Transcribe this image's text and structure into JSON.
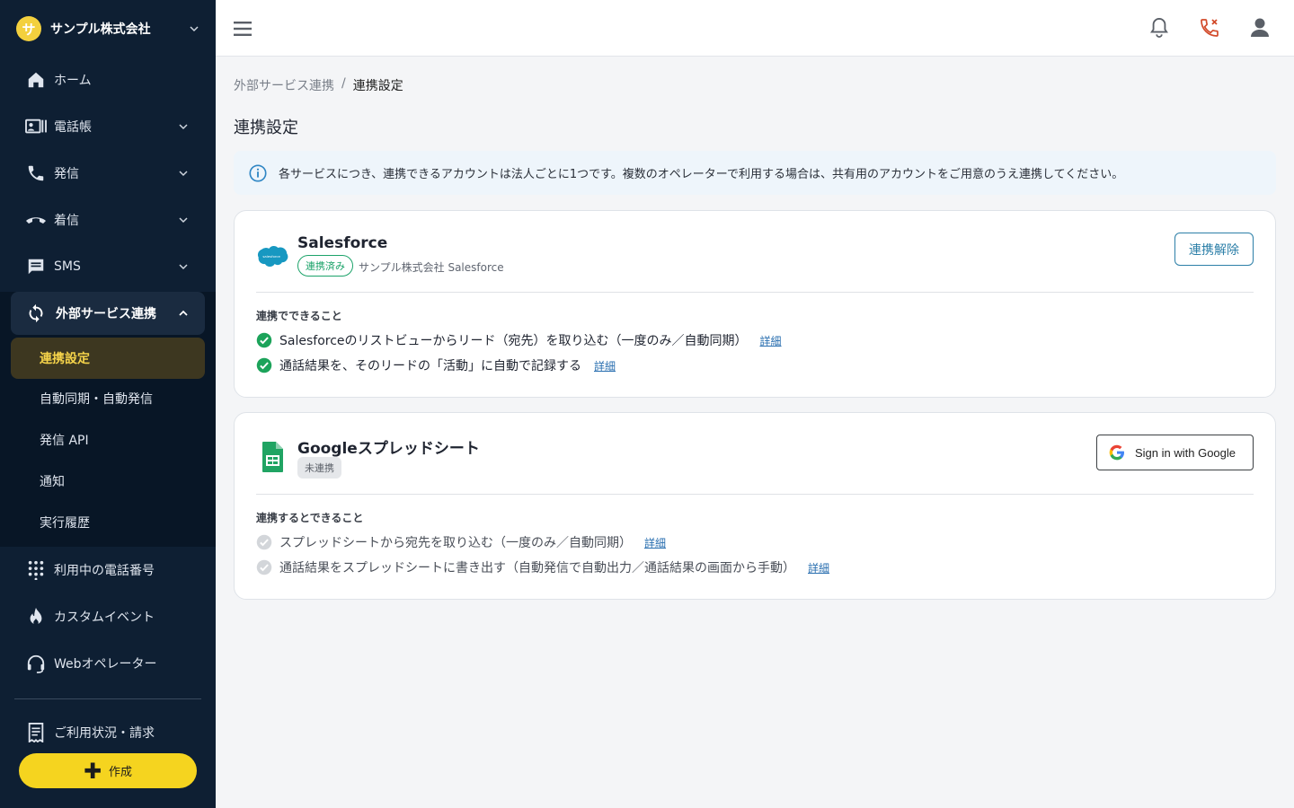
{
  "app": {
    "company": "サンプル株式会社",
    "company_initial": "サ",
    "accent": "#f5d41f"
  },
  "sidebar": {
    "items": [
      {
        "label": "ホーム",
        "icon": "home-icon"
      },
      {
        "label": "電話帳",
        "icon": "contacts-icon"
      },
      {
        "label": "発信",
        "icon": "phone-icon"
      },
      {
        "label": "着信",
        "icon": "incoming-call-icon"
      },
      {
        "label": "SMS",
        "icon": "message-icon"
      },
      {
        "label": "外部サービス連携",
        "icon": "sync-icon"
      },
      {
        "label": "利用中の電話番号",
        "icon": "dialpad-icon"
      },
      {
        "label": "カスタムイベント",
        "icon": "flame-icon"
      },
      {
        "label": "Webオペレーター",
        "icon": "headset-icon"
      },
      {
        "label": "ご利用状況・請求",
        "icon": "receipt-icon"
      }
    ],
    "sub_items": [
      {
        "label": "連携設定"
      },
      {
        "label": "自動同期・自動発信"
      },
      {
        "label": "発信 API"
      },
      {
        "label": "通知"
      },
      {
        "label": "実行履歴"
      }
    ],
    "create_label": "作成"
  },
  "breadcrumb": {
    "parent": "外部サービス連携",
    "separator": "/",
    "current": "連携設定"
  },
  "page_title": "連携設定",
  "info": "各サービスにつき、連携できるアカウントは法人ごとに1つです。複数のオペレーターで利用する場合は、共有用のアカウントをご用意のうえ連携してください。",
  "salesforce": {
    "name": "Salesforce",
    "status": "連携済み",
    "account": "サンプル株式会社 Salesforce",
    "logo_text": "salesforce",
    "button": "連携解除",
    "section_title": "連携でできること",
    "features": [
      {
        "text": "Salesforceのリストビューからリード（宛先）を取り込む（一度のみ／自動同期）",
        "link": "詳細"
      },
      {
        "text": "通話結果を、そのリードの「活動」に自動で記録する",
        "link": "詳細"
      }
    ]
  },
  "google": {
    "name": "Googleスプレッドシート",
    "status": "未連携",
    "button": "Sign in with Google",
    "section_title": "連携するとできること",
    "features": [
      {
        "text": "スプレッドシートから宛先を取り込む（一度のみ／自動同期）",
        "link": "詳細"
      },
      {
        "text": "通話結果をスプレッドシートに書き出す（自動発信で自動出力／通話結果の画面から手動）",
        "link": "詳細"
      }
    ]
  }
}
